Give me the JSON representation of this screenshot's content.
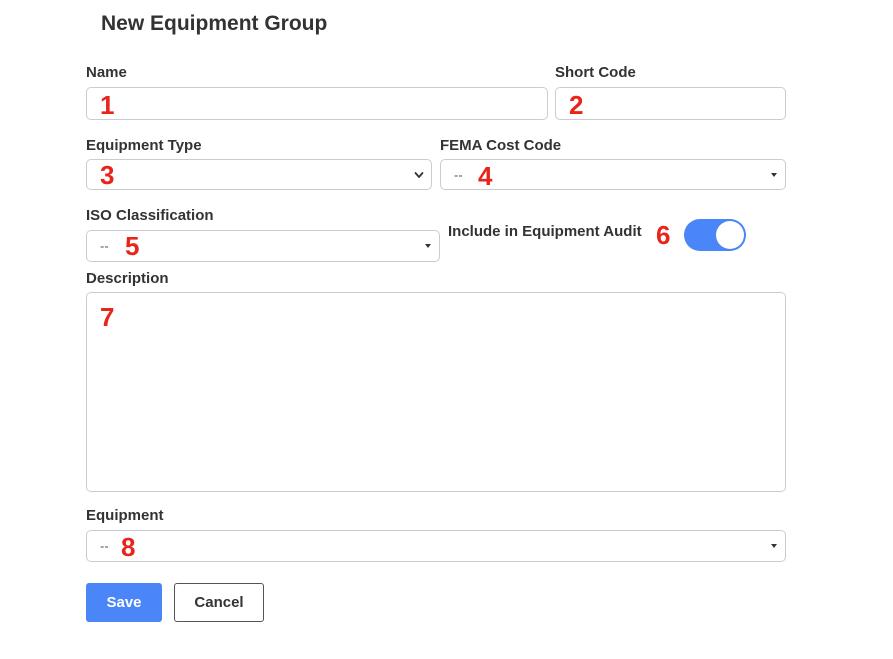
{
  "form": {
    "title": "New Equipment Group",
    "name_label": "Name",
    "short_code_label": "Short Code",
    "equipment_type_label": "Equipment Type",
    "fema_cost_code_label": "FEMA Cost Code",
    "fema_cost_code_value": "--",
    "iso_classification_label": "ISO Classification",
    "iso_classification_value": "--",
    "include_in_audit_label": "Include in Equipment Audit",
    "include_in_audit_on": true,
    "description_label": "Description",
    "equipment_label": "Equipment",
    "equipment_value": "--",
    "save_label": "Save",
    "cancel_label": "Cancel"
  },
  "annotations": [
    "1",
    "2",
    "3",
    "4",
    "5",
    "6",
    "7",
    "8"
  ],
  "colors": {
    "accent": "#4a86f7",
    "annotation_red": "#e8251b",
    "border": "#c9cdd2",
    "text": "#333333"
  }
}
